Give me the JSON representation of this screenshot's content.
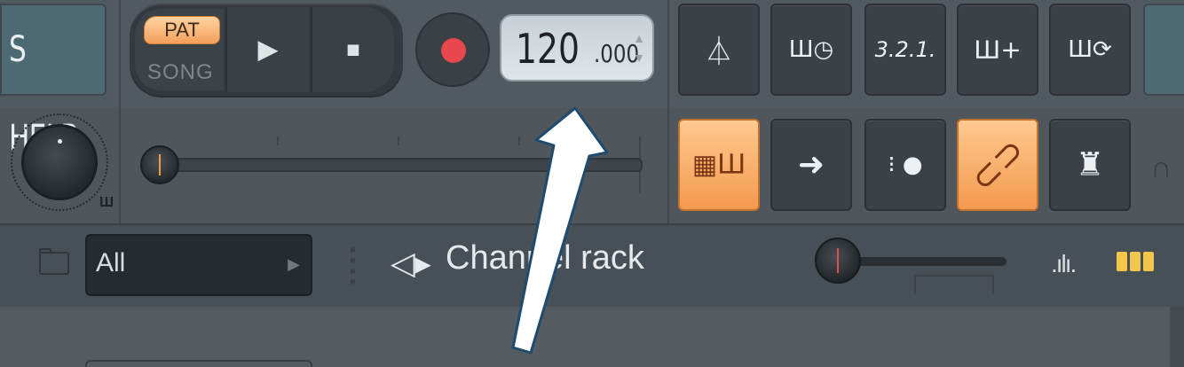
{
  "menu": {
    "help_label": "S HELP"
  },
  "transport": {
    "pat_label": "PAT",
    "song_label": "SONG",
    "play_icon": "play-icon",
    "stop_icon": "stop-icon",
    "record_icon": "record-icon"
  },
  "tempo": {
    "integer": "120",
    "fraction": ".000"
  },
  "toolbar_top": [
    {
      "name": "metronome",
      "glyph": "⏃"
    },
    {
      "name": "wait-for-input",
      "glyph": "Ш◷"
    },
    {
      "name": "countdown",
      "glyph": "3.2.1."
    },
    {
      "name": "step-edit",
      "glyph": "Ш+"
    },
    {
      "name": "loop-record",
      "glyph": "Ш⟳"
    }
  ],
  "toolbar_bottom": [
    {
      "name": "typing-keyboard",
      "glyph": "▦Ш",
      "active": true
    },
    {
      "name": "arrow",
      "glyph": "➜",
      "active": false
    },
    {
      "name": "footstep",
      "glyph": "👣",
      "active": false
    },
    {
      "name": "link",
      "glyph": "🔗",
      "active": true
    },
    {
      "name": "mixer-knob",
      "glyph": "♜",
      "active": false
    }
  ],
  "channel_rack": {
    "filter_value": "All",
    "title": "Channel rack"
  },
  "colors": {
    "accent_orange": "#f39a4f",
    "record_red": "#e8474e",
    "panel": "#525a61"
  }
}
